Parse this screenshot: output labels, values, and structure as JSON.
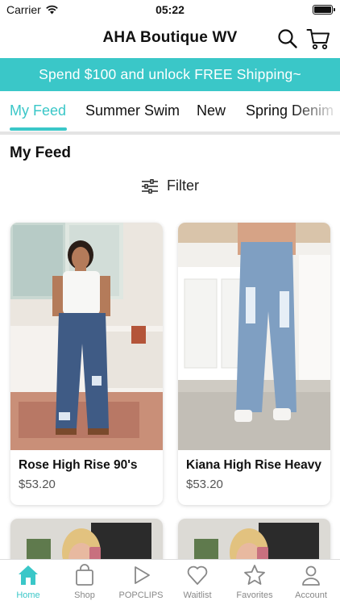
{
  "status_bar": {
    "carrier": "Carrier",
    "time": "05:22"
  },
  "header": {
    "title": "AHA Boutique WV"
  },
  "promo": {
    "text": "Spend $100 and unlock FREE Shipping~"
  },
  "colors": {
    "accent": "#3ac7c8"
  },
  "tabs": [
    {
      "label": "My Feed",
      "active": true
    },
    {
      "label": "Summer Swim"
    },
    {
      "label": "New"
    },
    {
      "label": "Spring Denim"
    }
  ],
  "section": {
    "title": "My Feed",
    "filter_label": "Filter"
  },
  "products": [
    {
      "name": "Rose High Rise 90's",
      "price": "$53.20"
    },
    {
      "name": "Kiana High Rise Heavy",
      "price": "$53.20"
    }
  ],
  "bottom_nav": [
    {
      "label": "Home",
      "icon": "home-icon",
      "active": true
    },
    {
      "label": "Shop",
      "icon": "shopping-bag-icon"
    },
    {
      "label": "POPCLIPS",
      "icon": "play-icon"
    },
    {
      "label": "Waitlist",
      "icon": "heart-icon"
    },
    {
      "label": "Favorites",
      "icon": "star-icon"
    },
    {
      "label": "Account",
      "icon": "person-icon"
    }
  ]
}
